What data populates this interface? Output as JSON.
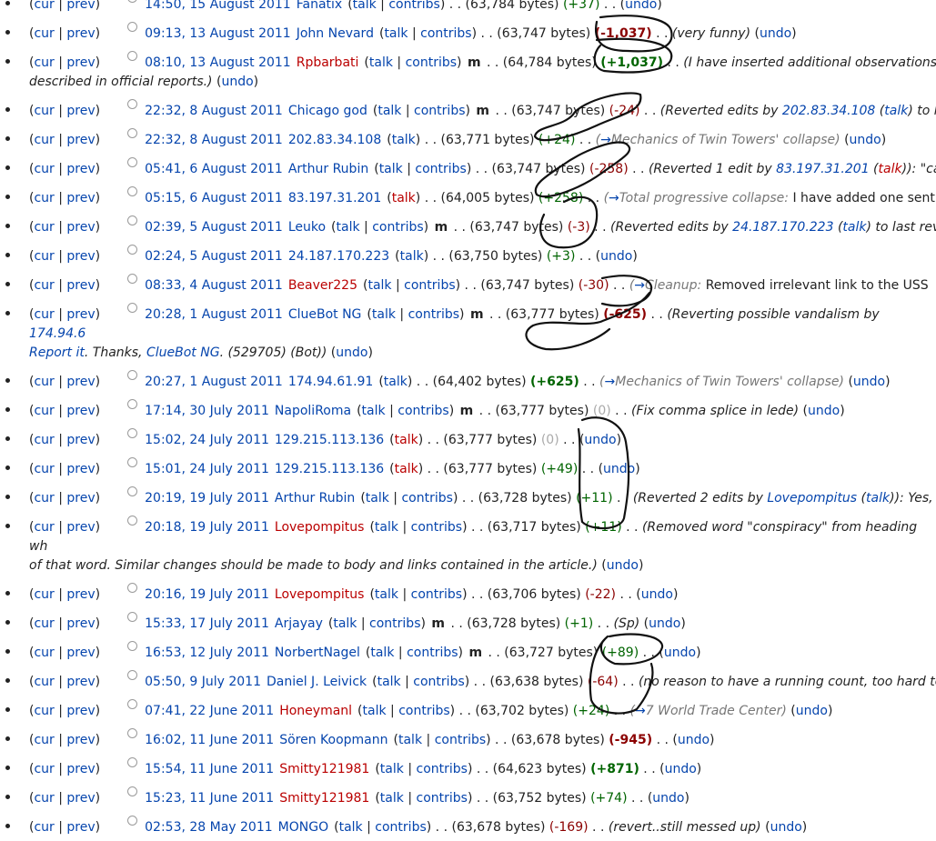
{
  "labels": {
    "cur": "cur",
    "prev": "prev",
    "talk": "talk",
    "contribs": "contribs",
    "minor": "m",
    "undo": "undo",
    "bytes_suffix": " bytes)"
  },
  "rows": [
    {
      "time": "14:50, 15 August 2011",
      "user": "Fanatix",
      "user_red": false,
      "has_contribs": true,
      "minor": false,
      "bytes": "63,784",
      "diff": "+37",
      "diff_class": "pos",
      "comment": ""
    },
    {
      "time": "09:13, 13 August 2011",
      "user": "John Nevard",
      "user_red": false,
      "has_contribs": true,
      "minor": false,
      "bytes": "63,747",
      "diff": "-1,037",
      "diff_class": "neg big",
      "comment": "(very funny)"
    },
    {
      "time": "08:10, 13 August 2011",
      "user": "Rpbarbati",
      "user_red": true,
      "has_contribs": true,
      "minor": true,
      "bytes": "64,784",
      "diff": "+1,037",
      "diff_class": "pos big",
      "comment": "(I have inserted additional observations",
      "wrap": "described in official reports.)"
    },
    {
      "time": "22:32, 8 August 2011",
      "user": "Chicago god",
      "user_red": false,
      "has_contribs": true,
      "minor": true,
      "bytes": "63,747",
      "diff": "-24",
      "diff_class": "neg",
      "comment": "(Reverted edits by ",
      "link": "202.83.34.108",
      "talk2": "talk",
      "tail": " to la"
    },
    {
      "time": "22:32, 8 August 2011",
      "user": "202.83.34.108",
      "user_red": false,
      "has_contribs": false,
      "talk_red": false,
      "minor": false,
      "bytes": "63,771",
      "diff": "+24",
      "diff_class": "pos",
      "auto": "Mechanics of Twin Towers' collapse"
    },
    {
      "time": "05:41, 6 August 2011",
      "user": "Arthur Rubin",
      "user_red": false,
      "has_contribs": true,
      "minor": false,
      "bytes": "63,747",
      "diff": "-258",
      "diff_class": "neg",
      "comment": "(Reverted 1 edit by ",
      "link": "83.197.31.201",
      "talk2": "talk",
      "talk2_red": true,
      "tail": "): \"car"
    },
    {
      "time": "05:15, 6 August 2011",
      "user": "83.197.31.201",
      "user_red": false,
      "has_contribs": false,
      "talk_red": true,
      "minor": false,
      "bytes": "64,005",
      "diff": "+258",
      "diff_class": "pos",
      "auto_cut": "Total progressive collapse:",
      "auto_text": " I have added one sent"
    },
    {
      "time": "02:39, 5 August 2011",
      "user": "Leuko",
      "user_red": false,
      "has_contribs": true,
      "minor": true,
      "bytes": "63,747",
      "diff": "-3",
      "diff_class": "neg",
      "comment": "(Reverted edits by ",
      "link": "24.187.170.223",
      "talk2": "talk",
      "tail": " to last revi"
    },
    {
      "time": "02:24, 5 August 2011",
      "user": "24.187.170.223",
      "user_red": false,
      "has_contribs": false,
      "talk_red": false,
      "minor": false,
      "bytes": "63,750",
      "diff": "+3",
      "diff_class": "pos",
      "comment": ""
    },
    {
      "time": "08:33, 4 August 2011",
      "user": "Beaver225",
      "user_red": true,
      "has_contribs": true,
      "minor": false,
      "bytes": "63,747",
      "diff": "-30",
      "diff_class": "neg",
      "auto_cut": "Cleanup:",
      "auto_text": " Removed irrelevant link to the USS "
    },
    {
      "time": "20:28, 1 August 2011",
      "user": "ClueBot NG",
      "user_red": false,
      "has_contribs": true,
      "minor": true,
      "bytes": "63,777",
      "diff": "-625",
      "diff_class": "neg big",
      "comment": "(Reverting possible vandalism by ",
      "link": "174.94.6",
      "wrap_link1": "Report it",
      "wrap_text1": ". Thanks, ",
      "wrap_link2": "ClueBot NG",
      "wrap_text2": ". (529705) (Bot))"
    },
    {
      "time": "20:27, 1 August 2011",
      "user": "174.94.61.91",
      "user_red": false,
      "has_contribs": false,
      "talk_red": false,
      "minor": false,
      "bytes": "64,402",
      "diff": "+625",
      "diff_class": "pos big",
      "auto": "Mechanics of Twin Towers' collapse"
    },
    {
      "time": "17:14, 30 July 2011",
      "user": "NapoliRoma",
      "user_red": false,
      "has_contribs": true,
      "minor": true,
      "bytes": "63,777",
      "diff": "0",
      "diff_class": "zero",
      "comment": "(Fix comma splice in lede)"
    },
    {
      "time": "15:02, 24 July 2011",
      "user": "129.215.113.136",
      "user_red": false,
      "has_contribs": false,
      "talk_red": true,
      "minor": false,
      "bytes": "63,777",
      "diff": "0",
      "diff_class": "zero",
      "comment": ""
    },
    {
      "time": "15:01, 24 July 2011",
      "user": "129.215.113.136",
      "user_red": false,
      "has_contribs": false,
      "talk_red": true,
      "minor": false,
      "bytes": "63,777",
      "diff": "+49",
      "diff_class": "pos",
      "comment": ""
    },
    {
      "time": "20:19, 19 July 2011",
      "user": "Arthur Rubin",
      "user_red": false,
      "has_contribs": true,
      "minor": false,
      "bytes": "63,728",
      "diff": "+11",
      "diff_class": "pos",
      "comment": "(Reverted 2 edits by ",
      "link": "Lovepompitus",
      "talk2": "talk",
      "tail": "): Yes, th"
    },
    {
      "time": "20:18, 19 July 2011",
      "user": "Lovepompitus",
      "user_red": true,
      "has_contribs": true,
      "minor": false,
      "bytes": "63,717",
      "diff": "+11",
      "diff_class": "pos",
      "comment": "(Removed word \"conspiracy\" from heading wh",
      "wrap": "of that word. Similar changes should be made to body and links contained in the article.)"
    },
    {
      "time": "20:16, 19 July 2011",
      "user": "Lovepompitus",
      "user_red": true,
      "has_contribs": true,
      "minor": false,
      "bytes": "63,706",
      "diff": "-22",
      "diff_class": "neg",
      "comment": ""
    },
    {
      "time": "15:33, 17 July 2011",
      "user": "Arjayay",
      "user_red": false,
      "has_contribs": true,
      "minor": true,
      "bytes": "63,728",
      "diff": "+1",
      "diff_class": "pos",
      "comment": "(Sp)"
    },
    {
      "time": "16:53, 12 July 2011",
      "user": "NorbertNagel",
      "user_red": false,
      "has_contribs": true,
      "minor": true,
      "bytes": "63,727",
      "diff": "+89",
      "diff_class": "pos",
      "comment": ""
    },
    {
      "time": "05:50, 9 July 2011",
      "user": "Daniel J. Leivick",
      "user_red": false,
      "has_contribs": true,
      "minor": false,
      "bytes": "63,638",
      "diff": "-64",
      "diff_class": "neg",
      "comment": "(no reason to have a running count, too hard to"
    },
    {
      "time": "07:41, 22 June 2011",
      "user": "Honeymanl",
      "user_red": true,
      "has_contribs": true,
      "minor": false,
      "bytes": "63,702",
      "diff": "+24",
      "diff_class": "pos",
      "auto": "7 World Trade Center"
    },
    {
      "time": "16:02, 11 June 2011",
      "user": "Sören Koopmann",
      "user_red": false,
      "has_contribs": true,
      "minor": false,
      "bytes": "63,678",
      "diff": "-945",
      "diff_class": "neg big",
      "comment": ""
    },
    {
      "time": "15:54, 11 June 2011",
      "user": "Smitty121981",
      "user_red": true,
      "has_contribs": true,
      "minor": false,
      "bytes": "64,623",
      "diff": "+871",
      "diff_class": "pos big",
      "comment": ""
    },
    {
      "time": "15:23, 11 June 2011",
      "user": "Smitty121981",
      "user_red": true,
      "has_contribs": true,
      "minor": false,
      "bytes": "63,752",
      "diff": "+74",
      "diff_class": "pos",
      "comment": ""
    },
    {
      "time": "02:53, 28 May 2011",
      "user": "MONGO",
      "user_red": false,
      "has_contribs": true,
      "minor": false,
      "bytes": "63,678",
      "diff": "-169",
      "diff_class": "neg",
      "comment": "(revert..still messed up)"
    }
  ]
}
